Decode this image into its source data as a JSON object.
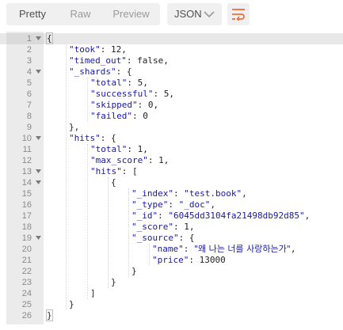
{
  "toolbar": {
    "tabs": [
      "Pretty",
      "Raw",
      "Preview"
    ],
    "active_tab": "Pretty",
    "format": "JSON",
    "wrap_icon": "wrap-lines-icon",
    "accent_color": "#f26b3a"
  },
  "editor": {
    "lines": [
      {
        "n": "1",
        "fold": true,
        "parts": [
          [
            "p",
            "{"
          ]
        ]
      },
      {
        "n": "2",
        "parts": [
          [
            "k",
            "\"took\""
          ],
          [
            "p",
            ": 12,"
          ]
        ]
      },
      {
        "n": "3",
        "parts": [
          [
            "k",
            "\"timed_out\""
          ],
          [
            "p",
            ": false,"
          ]
        ]
      },
      {
        "n": "4",
        "fold": true,
        "parts": [
          [
            "k",
            "\"_shards\""
          ],
          [
            "p",
            ": {"
          ]
        ]
      },
      {
        "n": "5",
        "parts": [
          [
            "k",
            "\"total\""
          ],
          [
            "p",
            ": 5,"
          ]
        ]
      },
      {
        "n": "6",
        "parts": [
          [
            "k",
            "\"successful\""
          ],
          [
            "p",
            ": 5,"
          ]
        ]
      },
      {
        "n": "7",
        "parts": [
          [
            "k",
            "\"skipped\""
          ],
          [
            "p",
            ": 0,"
          ]
        ]
      },
      {
        "n": "8",
        "parts": [
          [
            "k",
            "\"failed\""
          ],
          [
            "p",
            ": 0"
          ]
        ]
      },
      {
        "n": "9",
        "parts": [
          [
            "p",
            "},"
          ]
        ]
      },
      {
        "n": "10",
        "fold": true,
        "parts": [
          [
            "k",
            "\"hits\""
          ],
          [
            "p",
            ": {"
          ]
        ]
      },
      {
        "n": "11",
        "parts": [
          [
            "k",
            "\"total\""
          ],
          [
            "p",
            ": 1,"
          ]
        ]
      },
      {
        "n": "12",
        "parts": [
          [
            "k",
            "\"max_score\""
          ],
          [
            "p",
            ": 1,"
          ]
        ]
      },
      {
        "n": "13",
        "fold": true,
        "parts": [
          [
            "k",
            "\"hits\""
          ],
          [
            "p",
            ": ["
          ]
        ]
      },
      {
        "n": "14",
        "fold": true,
        "parts": [
          [
            "p",
            "{"
          ]
        ]
      },
      {
        "n": "15",
        "parts": [
          [
            "k",
            "\"_index\""
          ],
          [
            "p",
            ": "
          ],
          [
            "s",
            "\"test.book\""
          ],
          [
            "p",
            ","
          ]
        ]
      },
      {
        "n": "16",
        "parts": [
          [
            "k",
            "\"_type\""
          ],
          [
            "p",
            ": "
          ],
          [
            "s",
            "\"_doc\""
          ],
          [
            "p",
            ","
          ]
        ]
      },
      {
        "n": "17",
        "parts": [
          [
            "k",
            "\"_id\""
          ],
          [
            "p",
            ": "
          ],
          [
            "s",
            "\"6045dd3104fa21498db92d85\""
          ],
          [
            "p",
            ","
          ]
        ]
      },
      {
        "n": "18",
        "parts": [
          [
            "k",
            "\"_score\""
          ],
          [
            "p",
            ": 1,"
          ]
        ]
      },
      {
        "n": "19",
        "fold": true,
        "parts": [
          [
            "k",
            "\"_source\""
          ],
          [
            "p",
            ": {"
          ]
        ]
      },
      {
        "n": "20",
        "parts": [
          [
            "k",
            "\"name\""
          ],
          [
            "p",
            ": "
          ],
          [
            "kr",
            "\"왜 나는 너를 사랑하는가\""
          ],
          [
            "p",
            ","
          ]
        ]
      },
      {
        "n": "21",
        "parts": [
          [
            "k",
            "\"price\""
          ],
          [
            "p",
            ": 13000"
          ]
        ]
      },
      {
        "n": "22",
        "parts": [
          [
            "p",
            "}"
          ]
        ]
      },
      {
        "n": "23",
        "parts": [
          [
            "p",
            "}"
          ]
        ]
      },
      {
        "n": "24",
        "parts": [
          [
            "p",
            "]"
          ]
        ]
      },
      {
        "n": "25",
        "parts": [
          [
            "p",
            "}"
          ]
        ]
      },
      {
        "n": "26",
        "parts": [
          [
            "p",
            "}"
          ]
        ]
      }
    ]
  }
}
